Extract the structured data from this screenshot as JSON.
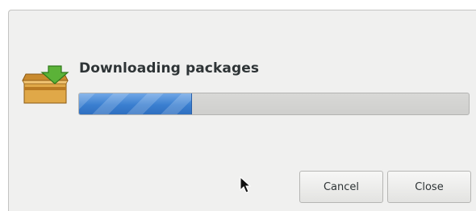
{
  "dialog": {
    "title": "Downloading packages",
    "progress_fraction": 0.29,
    "icon": "package-icon",
    "buttons": {
      "cancel_label": "Cancel",
      "close_label": "Close"
    }
  },
  "colors": {
    "progress_fill": "#3a7fd0",
    "progress_trough": "#d4d4d2",
    "dialog_bg": "#f0f0ef"
  }
}
